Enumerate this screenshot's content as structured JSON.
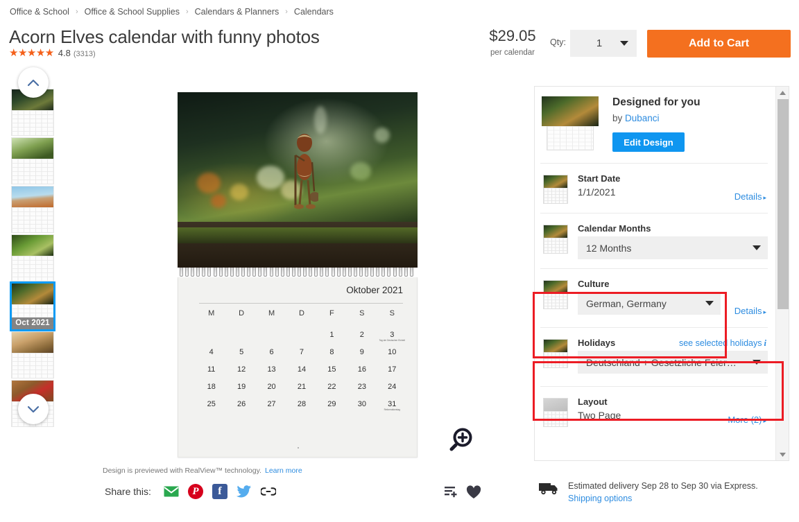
{
  "breadcrumb": {
    "separator": "›",
    "items": [
      "Office & School",
      "Office & School Supplies",
      "Calendars & Planners",
      "Calendars"
    ]
  },
  "product": {
    "title": "Acorn Elves calendar with funny photos",
    "stars": "★★★★★",
    "rating": "4.8",
    "review_count": "(3313)",
    "price": "$29.05",
    "price_unit": "per calendar"
  },
  "purchase": {
    "qty_label": "Qty:",
    "qty_value": "1",
    "add_to_cart_label": "Add to Cart"
  },
  "thumbnails": {
    "scroll_up_name": "chevron-up-icon",
    "scroll_down_name": "chevron-down-icon",
    "selected_label": "Oct 2021",
    "selected_index": 4
  },
  "preview": {
    "month_title": "Oktober 2021",
    "weekdays": [
      "M",
      "D",
      "M",
      "D",
      "F",
      "S",
      "S"
    ],
    "weeks": [
      [
        "",
        "",
        "",
        "",
        "1",
        "2",
        "3"
      ],
      [
        "4",
        "5",
        "6",
        "7",
        "8",
        "9",
        "10"
      ],
      [
        "11",
        "12",
        "13",
        "14",
        "15",
        "16",
        "17"
      ],
      [
        "18",
        "19",
        "20",
        "21",
        "22",
        "23",
        "24"
      ],
      [
        "25",
        "26",
        "27",
        "28",
        "29",
        "30",
        "31"
      ]
    ],
    "holiday_notes": {
      "3": "Tag der Deutschen Einheit",
      "31": "Reformationstag"
    },
    "realview_note": "Design is previewed with RealView™ technology.",
    "realview_link": "Learn more",
    "zoom_icon_name": "zoom-in-icon"
  },
  "share": {
    "label": "Share this:",
    "icons": [
      "email-icon",
      "pinterest-icon",
      "facebook-icon",
      "twitter-icon",
      "copy-link-icon"
    ],
    "pinterest_glyph": "P",
    "facebook_glyph": "f"
  },
  "actions": {
    "add_to_list_icon": "add-to-list-icon",
    "favorite_icon": "heart-icon"
  },
  "options": {
    "designed": {
      "title": "Designed for you",
      "by_prefix": "by ",
      "designer": "Dubanci",
      "edit_button": "Edit Design"
    },
    "rows": [
      {
        "id": "start-date",
        "title": "Start Date",
        "value": "1/1/2021",
        "type": "text",
        "details": "Details",
        "details_arrow": "▸"
      },
      {
        "id": "calendar-months",
        "title": "Calendar Months",
        "value": "12 Months",
        "type": "select",
        "details": "",
        "details_arrow": ""
      },
      {
        "id": "culture",
        "title": "Culture",
        "value": "German, Germany",
        "type": "select",
        "details": "Details",
        "details_arrow": "▸"
      },
      {
        "id": "holidays",
        "title": "Holidays",
        "value": "Deutschland + Gesetzliche Feier…",
        "type": "select",
        "side_link": "see selected holidays",
        "side_link_icon": "i",
        "details": "",
        "details_arrow": ""
      },
      {
        "id": "layout",
        "title": "Layout",
        "value": "Two Page",
        "type": "text",
        "more_link": "More (2)",
        "details_arrow": "▸"
      }
    ],
    "scrollbar": {
      "up_icon": "scroll-up-arrow-icon",
      "down_icon": "scroll-down-arrow-icon"
    }
  },
  "delivery": {
    "icon": "truck-icon",
    "text": "Estimated delivery Sep 28 to Sep 30 via Express.",
    "link": "Shipping options"
  },
  "highlights": {
    "color": "#ec1c24",
    "boxes": [
      "culture-row",
      "holidays-row"
    ]
  },
  "colors": {
    "accent_orange": "#f4701f",
    "link_blue": "#2d8ce0",
    "edit_blue": "#0f96f0",
    "select_bg": "#efefef",
    "highlight_red": "#ec1c24"
  }
}
